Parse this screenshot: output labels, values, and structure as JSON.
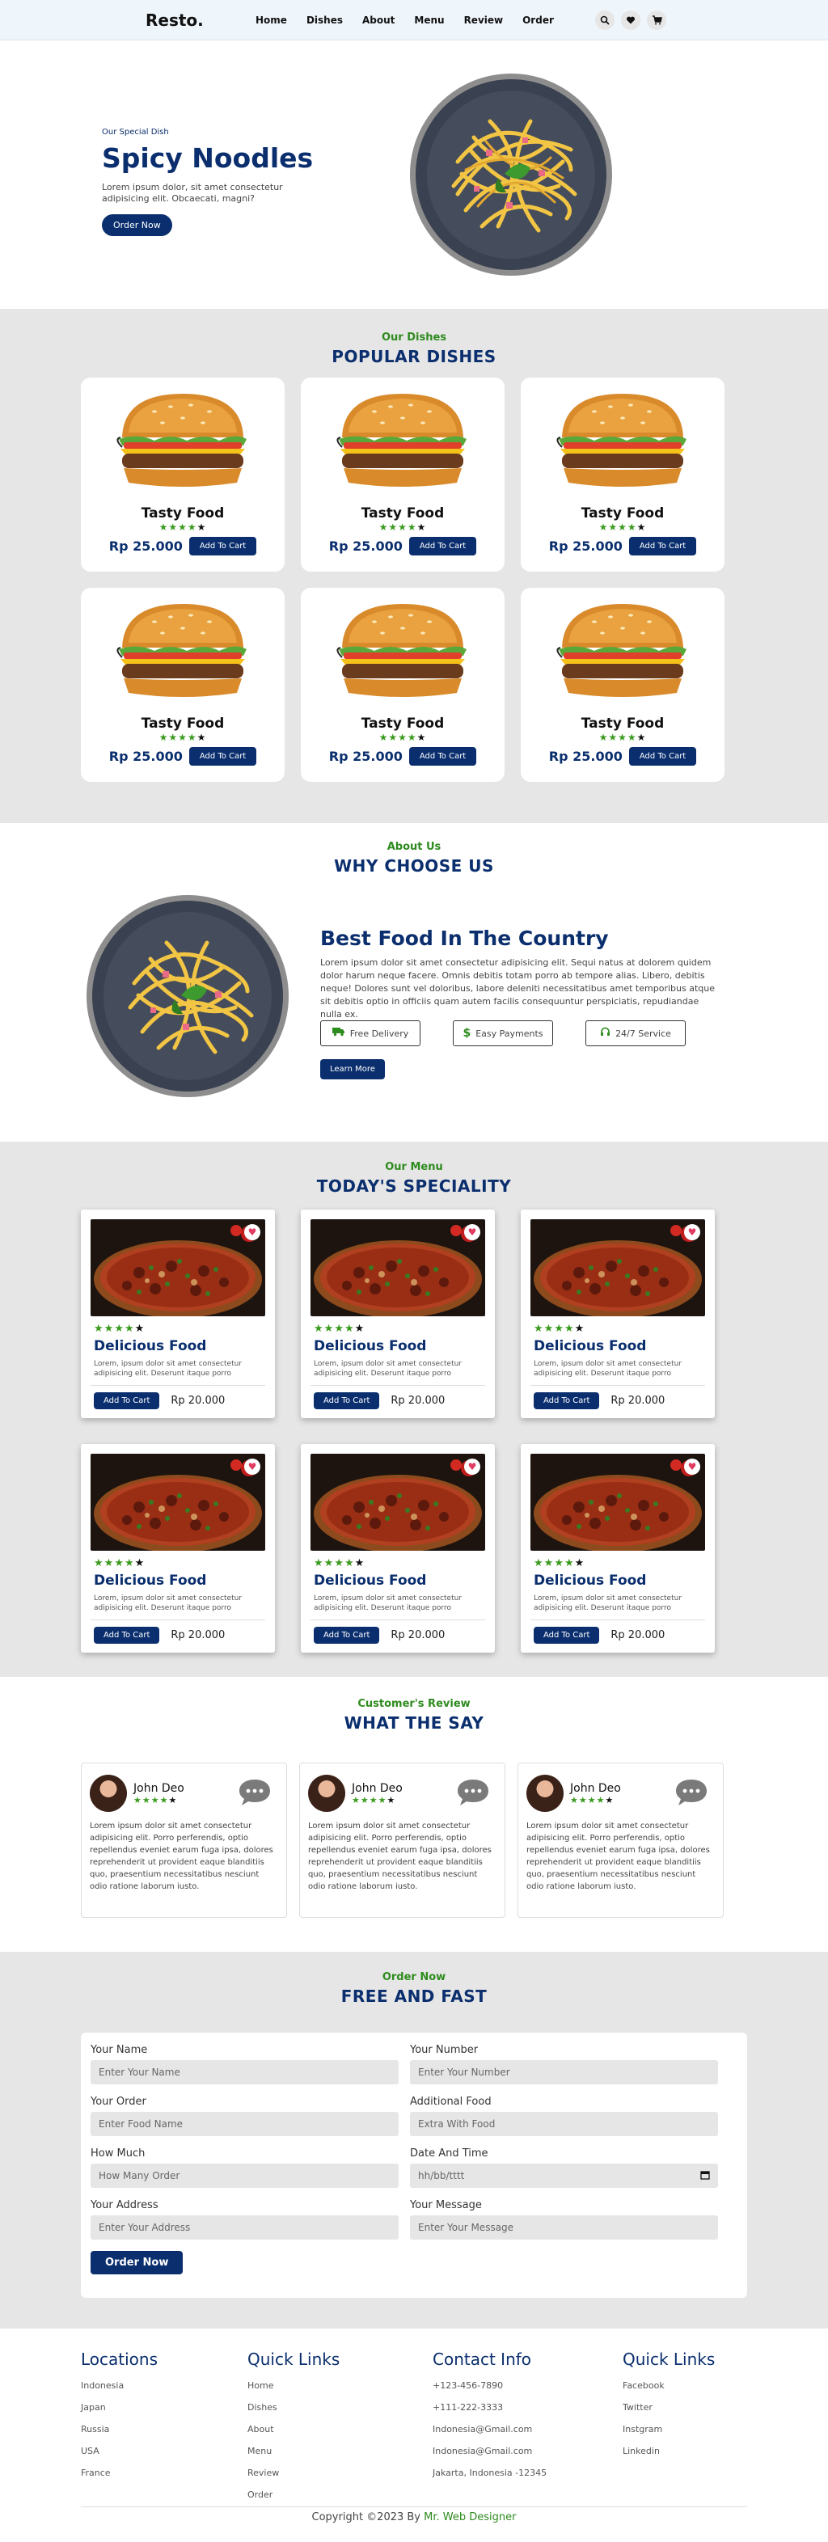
{
  "header": {
    "logo": "Resto.",
    "nav": [
      "Home",
      "Dishes",
      "About",
      "Menu",
      "Review",
      "Order"
    ]
  },
  "hero": {
    "sub": "Our Special Dish",
    "title": "Spicy Noodles",
    "text": "Lorem ipsum dolor, sit amet consectetur adipisicing elit. Obcaecati, magni?",
    "button": "Order Now"
  },
  "popular": {
    "sub": "Our Dishes",
    "title": "POPULAR DISHES",
    "items": [
      {
        "name": "Tasty Food",
        "price": "Rp 25.000",
        "button": "Add To Cart",
        "rating": 4
      },
      {
        "name": "Tasty Food",
        "price": "Rp 25.000",
        "button": "Add To Cart",
        "rating": 4
      },
      {
        "name": "Tasty Food",
        "price": "Rp 25.000",
        "button": "Add To Cart",
        "rating": 4
      },
      {
        "name": "Tasty Food",
        "price": "Rp 25.000",
        "button": "Add To Cart",
        "rating": 4
      },
      {
        "name": "Tasty Food",
        "price": "Rp 25.000",
        "button": "Add To Cart",
        "rating": 4
      },
      {
        "name": "Tasty Food",
        "price": "Rp 25.000",
        "button": "Add To Cart",
        "rating": 4
      }
    ]
  },
  "why": {
    "sub": "About Us",
    "title": "WHY CHOOSE US",
    "heading": "Best Food In The Country",
    "text": "Lorem ipsum dolor sit amet consectetur adipisicing elit. Sequi natus at dolorem quidem dolor harum neque facere. Omnis debitis totam porro ab tempore alias. Libero, debitis neque! Dolores sunt vel doloribus, labore deleniti necessitatibus amet temporibus atque sit debitis optio in officiis quam autem facilis consequuntur perspiciatis, repudiandae nulla ex.",
    "features": [
      "Free Delivery",
      "Easy Payments",
      "24/7 Service"
    ],
    "button": "Learn More"
  },
  "special": {
    "sub": "Our Menu",
    "title": "TODAY'S SPECIALITY",
    "items": [
      {
        "title": "Delicious Food",
        "desc": "Lorem, ipsum dolor sit amet consectetur adipisicing elit. Deserunt itaque porro",
        "button": "Add To Cart",
        "price": "Rp 20.000",
        "rating": 4
      },
      {
        "title": "Delicious Food",
        "desc": "Lorem, ipsum dolor sit amet consectetur adipisicing elit. Deserunt itaque porro",
        "button": "Add To Cart",
        "price": "Rp 20.000",
        "rating": 4
      },
      {
        "title": "Delicious Food",
        "desc": "Lorem, ipsum dolor sit amet consectetur adipisicing elit. Deserunt itaque porro",
        "button": "Add To Cart",
        "price": "Rp 20.000",
        "rating": 4
      },
      {
        "title": "Delicious Food",
        "desc": "Lorem, ipsum dolor sit amet consectetur adipisicing elit. Deserunt itaque porro",
        "button": "Add To Cart",
        "price": "Rp 20.000",
        "rating": 4
      },
      {
        "title": "Delicious Food",
        "desc": "Lorem, ipsum dolor sit amet consectetur adipisicing elit. Deserunt itaque porro",
        "button": "Add To Cart",
        "price": "Rp 20.000",
        "rating": 4
      },
      {
        "title": "Delicious Food",
        "desc": "Lorem, ipsum dolor sit amet consectetur adipisicing elit. Deserunt itaque porro",
        "button": "Add To Cart",
        "price": "Rp 20.000",
        "rating": 4
      }
    ]
  },
  "reviews": {
    "sub": "Customer's Review",
    "title": "WHAT THE SAY",
    "items": [
      {
        "name": "John Deo",
        "rating": 4,
        "text": "Lorem ipsum dolor sit amet consectetur adipisicing elit. Porro perferendis, optio repellendus eveniet earum fuga ipsa, dolores reprehenderit ut provident eaque blanditiis quo, praesentium necessitatibus nesciunt odio ratione laborum iusto."
      },
      {
        "name": "John Deo",
        "rating": 4,
        "text": "Lorem ipsum dolor sit amet consectetur adipisicing elit. Porro perferendis, optio repellendus eveniet earum fuga ipsa, dolores reprehenderit ut provident eaque blanditiis quo, praesentium necessitatibus nesciunt odio ratione laborum iusto."
      },
      {
        "name": "John Deo",
        "rating": 4,
        "text": "Lorem ipsum dolor sit amet consectetur adipisicing elit. Porro perferendis, optio repellendus eveniet earum fuga ipsa, dolores reprehenderit ut provident eaque blanditiis quo, praesentium necessitatibus nesciunt odio ratione laborum iusto."
      }
    ]
  },
  "order": {
    "sub": "Order Now",
    "title": "FREE AND FAST",
    "fields": [
      {
        "label": "Your Name",
        "placeholder": "Enter Your Name"
      },
      {
        "label": "Your Number",
        "placeholder": "Enter Your Number"
      },
      {
        "label": "Your Order",
        "placeholder": "Enter Food Name"
      },
      {
        "label": "Additional Food",
        "placeholder": "Extra With Food"
      },
      {
        "label": "How Much",
        "placeholder": "How Many Order"
      },
      {
        "label": "Date And Time",
        "placeholder": "hh/bb/tttt"
      },
      {
        "label": "Your Address",
        "placeholder": "Enter Your Address"
      },
      {
        "label": "Your Message",
        "placeholder": "Enter Your Message"
      }
    ],
    "button": "Order Now"
  },
  "footer": {
    "columns": [
      {
        "title": "Locations",
        "items": [
          "Indonesia",
          "Japan",
          "Russia",
          "USA",
          "France"
        ]
      },
      {
        "title": "Quick Links",
        "items": [
          "Home",
          "Dishes",
          "About",
          "Menu",
          "Review",
          "Order"
        ]
      },
      {
        "title": "Contact Info",
        "items": [
          "+123-456-7890",
          "+111-222-3333",
          "Indonesia@Gmail.com",
          "Indonesia@Gmail.com",
          "Jakarta, Indonesia -12345"
        ]
      },
      {
        "title": "Quick Links",
        "items": [
          "Facebook",
          "Twitter",
          "Instgram",
          "Linkedin"
        ]
      }
    ],
    "copyright": "Copyright ©2023 By",
    "author": "Mr. Web Designer"
  },
  "colors": {
    "navy": "#0b2f6e",
    "green": "#2e8b1e",
    "gray_bg": "#e6e6e6"
  }
}
